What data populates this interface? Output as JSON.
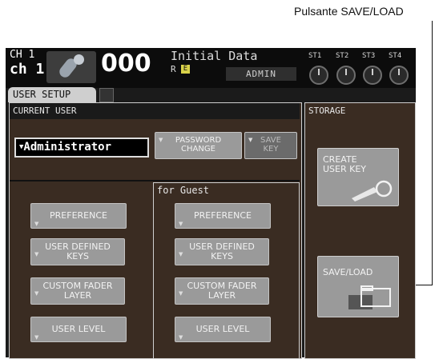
{
  "callout": {
    "label": "Pulsante SAVE/LOAD"
  },
  "topbar": {
    "channel_number": "CH 1",
    "channel_name": "ch 1",
    "scene_number": "000",
    "scene_title": "Initial Data",
    "scene_r": "R",
    "scene_e": "E",
    "user_level": "ADMIN",
    "st_labels": [
      "ST1",
      "ST2",
      "ST3",
      "ST4"
    ]
  },
  "tab": {
    "label": "USER SETUP"
  },
  "current_user": {
    "title": "CURRENT USER",
    "user_select_value": "Administrator",
    "password_change_label_1": "PASSWORD",
    "password_change_label_2": "CHANGE",
    "save_key_label_1": "SAVE",
    "save_key_label_2": "KEY",
    "preference_label": "PREFERENCE",
    "user_defined_keys_label_1": "USER DEFINED",
    "user_defined_keys_label_2": "KEYS",
    "custom_fader_layer_label_1": "CUSTOM FADER",
    "custom_fader_layer_label_2": "LAYER",
    "user_level_label": "USER LEVEL"
  },
  "guest": {
    "title": "for Guest",
    "preference_label": "PREFERENCE",
    "user_defined_keys_label_1": "USER DEFINED",
    "user_defined_keys_label_2": "KEYS",
    "custom_fader_layer_label_1": "CUSTOM FADER",
    "custom_fader_layer_label_2": "LAYER",
    "user_level_label": "USER LEVEL"
  },
  "storage": {
    "title": "STORAGE",
    "create_user_key_label_1": "CREATE",
    "create_user_key_label_2": "USER KEY",
    "save_load_label": "SAVE/LOAD"
  },
  "icons": [
    "microphone-icon",
    "key-icon",
    "folder-icon",
    "dropdown-arrow-icon",
    "knob-icon"
  ]
}
